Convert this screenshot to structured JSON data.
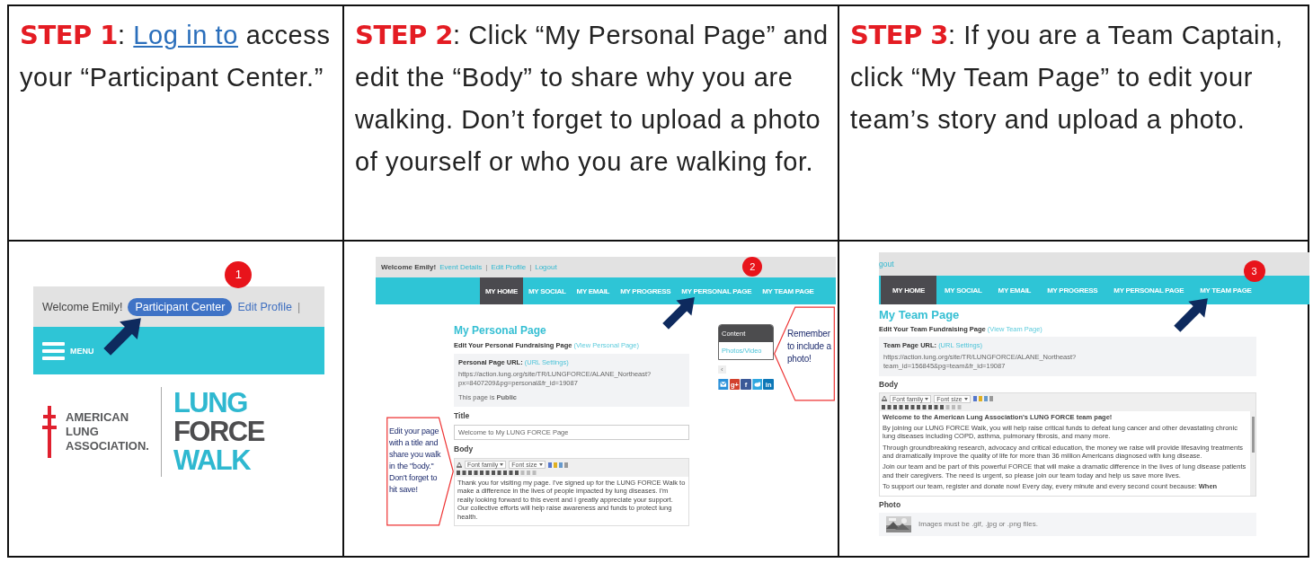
{
  "steps": [
    {
      "label": "STEP 1",
      "segments": [
        {
          "kind": "text",
          "text": ": "
        },
        {
          "kind": "link",
          "text": "Log in to"
        },
        {
          "kind": "text",
          "text": " access your “Participant Center.”"
        }
      ]
    },
    {
      "label": "STEP 2",
      "segments": [
        {
          "kind": "text",
          "text": ": Click “My Personal Page” and edit the “Body” to share why you are walking.  Don’t forget to upload a photo of yourself or who you are walking for."
        }
      ]
    },
    {
      "label": "STEP 3",
      "segments": [
        {
          "kind": "text",
          "text": ": If you are a Team Captain, click “My Team Page” to edit your team’s story and upload a photo."
        }
      ]
    }
  ],
  "welcome_screen": {
    "greeting": "Welcome Emily!",
    "links": [
      {
        "kind": "link",
        "text": "Participant Center",
        "selected": true,
        "pointed": true
      },
      {
        "kind": "link",
        "text": "Edit Profile",
        "selected": false,
        "pointed": false
      },
      {
        "kind": "sep",
        "text": "|"
      }
    ],
    "badge": "1",
    "menu_label": "MENU",
    "association_logo": [
      "AMERICAN",
      "LUNG",
      "ASSOCIATION."
    ],
    "walk_logo": [
      "LUNG",
      "FORCE",
      "WALK"
    ]
  },
  "screens": [
    {
      "top_links": [
        {
          "kind": "text",
          "text": "Welcome Emily!"
        },
        {
          "kind": "link",
          "text": "Event Details"
        },
        {
          "kind": "sep",
          "text": "|"
        },
        {
          "kind": "link",
          "text": "Edit Profile"
        },
        {
          "kind": "sep",
          "text": "|"
        },
        {
          "kind": "link",
          "text": "Logout"
        }
      ],
      "nav": [
        {
          "label": "MY HOME",
          "selected": true,
          "pointed": false
        },
        {
          "label": "MY SOCIAL",
          "selected": false,
          "pointed": false
        },
        {
          "label": "MY EMAIL",
          "selected": false,
          "pointed": false
        },
        {
          "label": "MY PROGRESS",
          "selected": false,
          "pointed": false
        },
        {
          "label": "MY PERSONAL PAGE",
          "selected": false,
          "pointed": true
        },
        {
          "label": "MY TEAM PAGE",
          "selected": false,
          "pointed": false
        }
      ],
      "badge": "2",
      "heading": "My Personal Page",
      "subheading": "Edit Your Personal Fundraising Page",
      "subheading_link": "(View Personal Page)",
      "url_label": "Personal Page URL:",
      "url_link": "(URL Settings)",
      "url_lines": [
        "https://action.lung.org/site/TR/LUNGFORCE/ALANE_Northeast?",
        "px=8407209&pg=personal&fr_id=19087"
      ],
      "visibility": "This page is **Public**",
      "title_label": "Title",
      "title_value": "Welcome to My LUNG FORCE Page",
      "body_label": "Body",
      "toolbar_fields": [
        "Font family",
        "Font size"
      ],
      "body": [
        {
          "text": "Thank you for visiting my page. I've signed up for the LUNG FORCE Walk to make a difference in the lives of people impacted by lung diseases. I'm really looking forward to this event and I greatly appreciate your support. Our collective efforts will help raise awareness and funds to protect lung health.",
          "bold": false
        }
      ],
      "sidebar": {
        "header": "Content",
        "link": "Photos/Video",
        "collapse": "‹",
        "share": [
          {
            "kind": "email",
            "color": "#2b90d9"
          },
          {
            "kind": "label",
            "text": "g+",
            "color": "#d2412e"
          },
          {
            "kind": "label",
            "text": "f",
            "color": "#3b5998"
          },
          {
            "kind": "twitter",
            "color": "#2ea7e0"
          },
          {
            "kind": "label",
            "text": "in",
            "color": "#0d77b7"
          }
        ]
      },
      "callouts": [
        {
          "kind": "left",
          "text": "Edit your page with a title and share you walk in the \"body.\" Don't forget to hit save!"
        },
        {
          "kind": "right",
          "text": "Remember to include a photo!"
        }
      ]
    },
    {
      "top_links": [
        {
          "kind": "link",
          "text": "gout"
        }
      ],
      "nav": [
        {
          "label": "MY HOME",
          "selected": true,
          "pointed": false
        },
        {
          "label": "MY SOCIAL",
          "selected": false,
          "pointed": false
        },
        {
          "label": "MY EMAIL",
          "selected": false,
          "pointed": false
        },
        {
          "label": "MY PROGRESS",
          "selected": false,
          "pointed": false
        },
        {
          "label": "MY PERSONAL PAGE",
          "selected": false,
          "pointed": false
        },
        {
          "label": "MY TEAM PAGE",
          "selected": false,
          "pointed": true
        }
      ],
      "badge": "3",
      "heading": "My Team Page",
      "subheading": "Edit Your Team Fundraising Page",
      "subheading_link": "(View Team Page)",
      "url_label": "Team Page URL:",
      "url_link": "(URL Settings)",
      "url_lines": [
        "https://action.lung.org/site/TR/LUNGFORCE/ALANE_Northeast?",
        "team_id=156845&pg=team&fr_id=19087"
      ],
      "body_label": "Body",
      "toolbar_fields": [
        "Font family",
        "Font size"
      ],
      "scrollbar": true,
      "body": [
        {
          "text": "Welcome to the American Lung Association's LUNG FORCE team page!",
          "bold": true
        },
        {
          "text": "By joining our LUNG FORCE Walk, you will help raise critical funds to defeat lung cancer and other devastating chronic lung diseases including COPD, asthma, pulmonary fibrosis, and many more.",
          "bold": false
        },
        {
          "text": "Through groundbreaking research, advocacy and critical education, the money we raise will provide lifesaving treatments and dramatically improve the quality of life for more than 36 million Americans diagnosed with lung disease.",
          "bold": false
        },
        {
          "text": "Join our team and be part of this powerful FORCE that will make a dramatic difference in the lives of lung disease patients and their caregivers.  The need is urgent, so please join our team today and help us save more lives.",
          "bold": false
        },
        {
          "text": "To support our team, register and donate now!  Every day, every minute and every second count because: **When**",
          "bold": false
        }
      ],
      "photo_label": "Photo",
      "photo_note": "Images must be .gif, .jpg or .png files."
    }
  ]
}
